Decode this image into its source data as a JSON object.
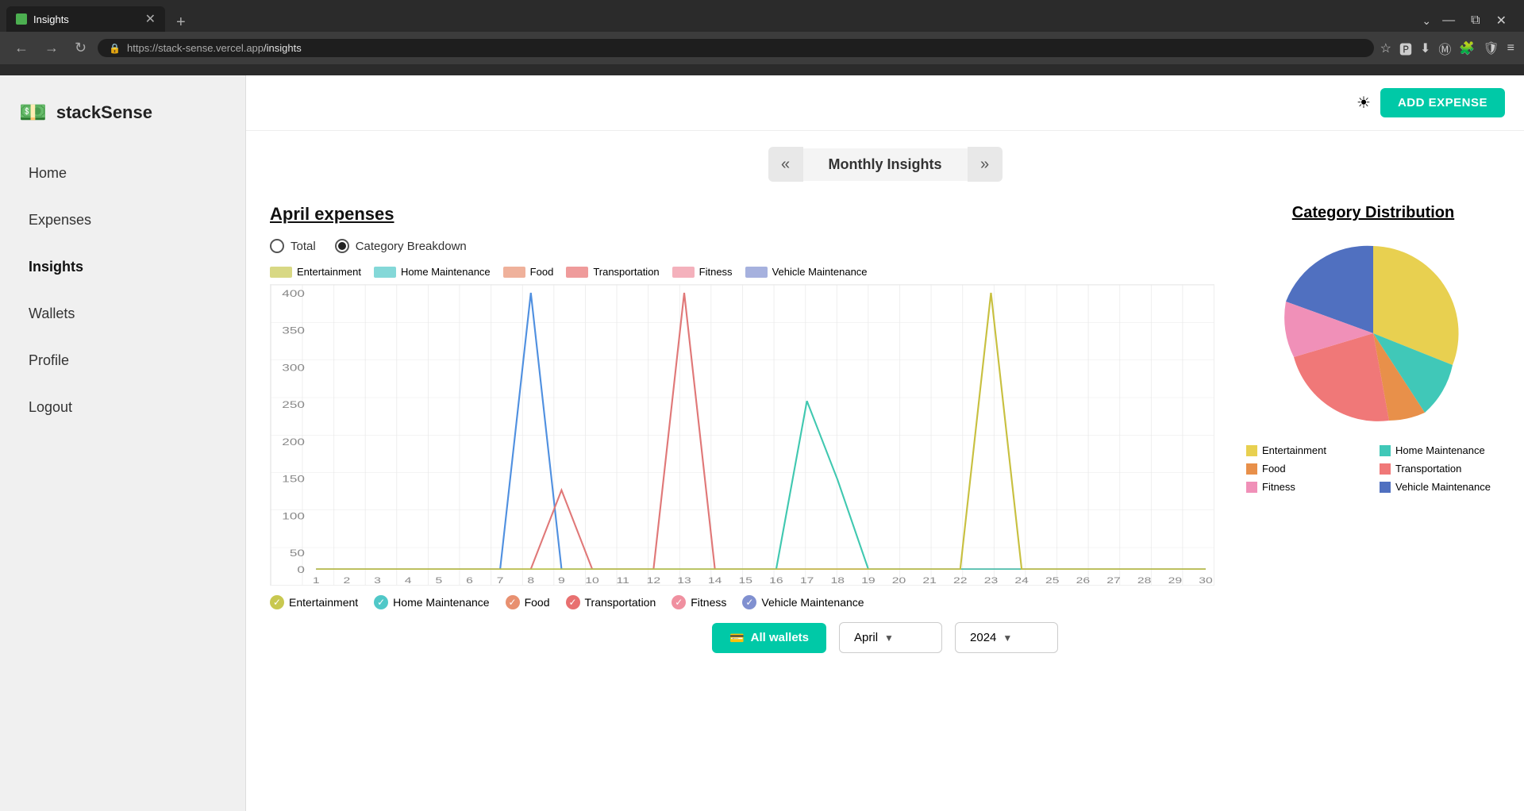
{
  "browser": {
    "tab_title": "Insights",
    "tab_favicon": "💵",
    "url_prefix": "https://stack-sense.vercel.app",
    "url_path": "/insights",
    "new_tab_label": "+",
    "back_icon": "←",
    "forward_icon": "→",
    "refresh_icon": "↻",
    "bookmark_icon": "☆",
    "extensions_icon": "🔧",
    "menu_icon": "≡",
    "dropdown_icon": "⌄",
    "minimize_icon": "—",
    "maximize_icon": "⧉",
    "close_icon": "✕"
  },
  "app": {
    "logo_icon": "💵",
    "logo_text": "stackSense",
    "theme_icon": "☀",
    "add_expense_label": "ADD EXPENSE"
  },
  "sidebar": {
    "items": [
      {
        "label": "Home",
        "active": false
      },
      {
        "label": "Expenses",
        "active": false
      },
      {
        "label": "Insights",
        "active": true
      },
      {
        "label": "Wallets",
        "active": false
      },
      {
        "label": "Profile",
        "active": false
      },
      {
        "label": "Logout",
        "active": false
      }
    ]
  },
  "monthly_nav": {
    "prev_icon": "«",
    "next_icon": "»",
    "title": "Monthly Insights"
  },
  "chart_section": {
    "title": "April expenses",
    "radio_options": [
      {
        "label": "Total",
        "checked": false
      },
      {
        "label": "Category Breakdown",
        "checked": true
      }
    ],
    "legend_items": [
      {
        "label": "Entertainment",
        "color": "#c8c850"
      },
      {
        "label": "Home Maintenance",
        "color": "#50c8c8"
      },
      {
        "label": "Food",
        "color": "#e89070"
      },
      {
        "label": "Transportation",
        "color": "#e87070"
      },
      {
        "label": "Fitness",
        "color": "#f090a0"
      },
      {
        "label": "Vehicle Maintenance",
        "color": "#8090d0"
      }
    ],
    "y_axis": [
      "400",
      "350",
      "300",
      "250",
      "200",
      "150",
      "100",
      "50",
      "0"
    ],
    "x_axis": [
      "1",
      "2",
      "3",
      "4",
      "5",
      "6",
      "7",
      "8",
      "9",
      "10",
      "11",
      "12",
      "13",
      "14",
      "15",
      "16",
      "17",
      "18",
      "19",
      "20",
      "21",
      "22",
      "23",
      "24",
      "25",
      "26",
      "27",
      "28",
      "29",
      "30"
    ],
    "checkboxes": [
      {
        "label": "Entertainment",
        "color": "#c8c850",
        "checked": true
      },
      {
        "label": "Home Maintenance",
        "color": "#50c8c8",
        "checked": true
      },
      {
        "label": "Food",
        "color": "#e89070",
        "checked": true
      },
      {
        "label": "Transportation",
        "color": "#e87070",
        "checked": true
      },
      {
        "label": "Fitness",
        "color": "#f090a0",
        "checked": true
      },
      {
        "label": "Vehicle Maintenance",
        "color": "#8090d0",
        "checked": true
      }
    ]
  },
  "pie_section": {
    "title": "Category Distribution",
    "legend": [
      {
        "label": "Entertainment",
        "color": "#e8d050"
      },
      {
        "label": "Home Maintenance",
        "color": "#40c8b8"
      },
      {
        "label": "Food",
        "color": "#e8904a"
      },
      {
        "label": "Transportation",
        "color": "#f07878"
      },
      {
        "label": "Fitness",
        "color": "#f090b8"
      },
      {
        "label": "Vehicle Maintenance",
        "color": "#5070c0"
      }
    ]
  },
  "bottom_filters": {
    "wallet_btn_icon": "💳",
    "wallet_btn_label": "All wallets",
    "month_label": "April",
    "month_arrow": "▼",
    "year_label": "2024",
    "year_arrow": "▼"
  }
}
